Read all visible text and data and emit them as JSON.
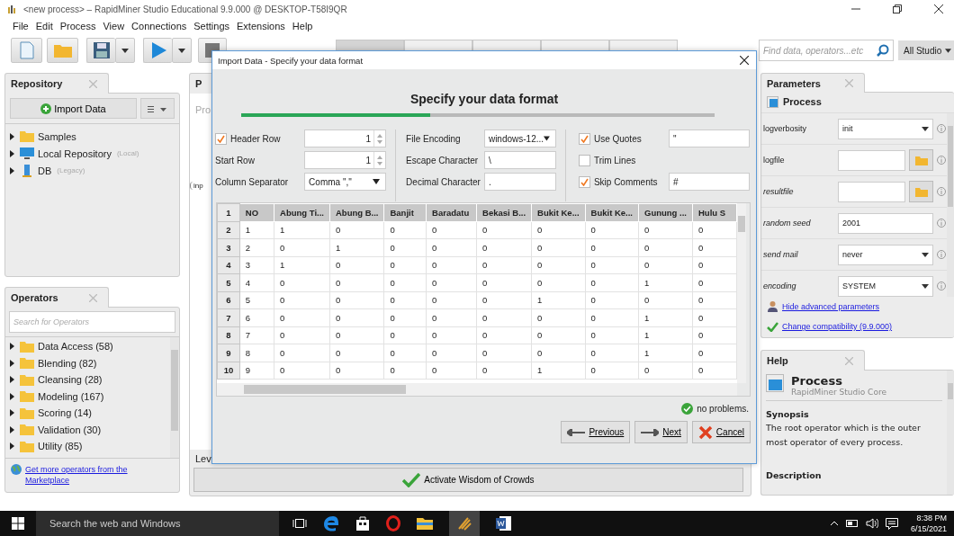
{
  "window": {
    "title": "<new process> – RapidMiner Studio Educational 9.9.000 @ DESKTOP-T58I9QR"
  },
  "menu": [
    "File",
    "Edit",
    "Process",
    "View",
    "Connections",
    "Settings",
    "Extensions",
    "Help"
  ],
  "views": {
    "tabs": [
      {
        "selected": true
      },
      {
        "selected": false
      },
      {
        "selected": false
      },
      {
        "selected": false
      },
      {
        "selected": false
      }
    ]
  },
  "search": {
    "placeholder": "Find data, operators...etc",
    "scope": "All Studio"
  },
  "repository": {
    "title": "Repository",
    "import_button": "Import Data",
    "items": [
      {
        "name": "Samples",
        "kind": "folder"
      },
      {
        "name": "Local Repository",
        "note": "(Local)",
        "kind": "computer"
      },
      {
        "name": "DB",
        "note": "(Legacy)",
        "kind": "database"
      }
    ]
  },
  "operators": {
    "title": "Operators",
    "search_placeholder": "Search for Operators",
    "items": [
      "Data Access (58)",
      "Blending (82)",
      "Cleansing (28)",
      "Modeling (167)",
      "Scoring (14)",
      "Validation (30)",
      "Utility (85)"
    ],
    "marketplace_link": "Get more operators from the Marketplace"
  },
  "process_panel": {
    "title": "P",
    "breadcrumb": "Pro",
    "port": "inp",
    "footer": "Lev",
    "wisdom_button": "Activate Wisdom of Crowds"
  },
  "dialog": {
    "title": "Import Data - Specify your data format",
    "heading": "Specify your data format",
    "progress": {
      "level": 0.4
    },
    "columns": [
      [
        {
          "label": "Header Row",
          "checked": true,
          "kind": "checkspinner",
          "value": "1"
        },
        {
          "label": "Start Row",
          "kind": "spinner",
          "value": "1"
        },
        {
          "label": "Column Separator",
          "kind": "select",
          "value": "Comma \",\""
        }
      ],
      [
        {
          "label": "File Encoding",
          "kind": "select",
          "value": "windows-12..."
        },
        {
          "label": "Escape Character",
          "kind": "text",
          "value": "\\"
        },
        {
          "label": "Decimal Character",
          "kind": "text",
          "value": "."
        }
      ],
      [
        {
          "label": "Use Quotes",
          "checked": true,
          "kind": "checktext",
          "value": "\""
        },
        {
          "label": "Trim Lines",
          "checked": false,
          "kind": "checkbox"
        },
        {
          "label": "Skip Comments",
          "checked": true,
          "kind": "checktext",
          "value": "#"
        }
      ]
    ],
    "table": {
      "header_number": "1",
      "columns": [
        "NO",
        "Abung Ti...",
        "Abung B...",
        "Banjit",
        "Baradatu",
        "Bekasi B...",
        "Bukit Ke...",
        "Bukit Ke...",
        "Gunung ...",
        "Hulu S"
      ],
      "rows": [
        {
          "number": "2",
          "cells": [
            "1",
            "1",
            "0",
            "0",
            "0",
            "0",
            "0",
            "0",
            "0",
            "0"
          ]
        },
        {
          "number": "3",
          "cells": [
            "2",
            "0",
            "1",
            "0",
            "0",
            "0",
            "0",
            "0",
            "0",
            "0"
          ]
        },
        {
          "number": "4",
          "cells": [
            "3",
            "1",
            "0",
            "0",
            "0",
            "0",
            "0",
            "0",
            "0",
            "0"
          ]
        },
        {
          "number": "5",
          "cells": [
            "4",
            "0",
            "0",
            "0",
            "0",
            "0",
            "0",
            "0",
            "1",
            "0"
          ]
        },
        {
          "number": "6",
          "cells": [
            "5",
            "0",
            "0",
            "0",
            "0",
            "0",
            "1",
            "0",
            "0",
            "0"
          ]
        },
        {
          "number": "7",
          "cells": [
            "6",
            "0",
            "0",
            "0",
            "0",
            "0",
            "0",
            "0",
            "1",
            "0"
          ]
        },
        {
          "number": "8",
          "cells": [
            "7",
            "0",
            "0",
            "0",
            "0",
            "0",
            "0",
            "0",
            "1",
            "0"
          ]
        },
        {
          "number": "9",
          "cells": [
            "8",
            "0",
            "0",
            "0",
            "0",
            "0",
            "0",
            "0",
            "1",
            "0"
          ]
        },
        {
          "number": "10",
          "cells": [
            "9",
            "0",
            "0",
            "0",
            "0",
            "0",
            "1",
            "0",
            "0",
            "0"
          ]
        }
      ]
    },
    "status": "no problems.",
    "buttons": [
      {
        "label": "Previous",
        "kind": "previous"
      },
      {
        "label": "Next",
        "kind": "next"
      },
      {
        "label": "Cancel",
        "kind": "cancel"
      }
    ]
  },
  "parameters": {
    "title": "Parameters",
    "operator": "Process",
    "rows": [
      {
        "name": "logverbosity",
        "italic": false,
        "kind": "select",
        "value": "init"
      },
      {
        "name": "logfile",
        "italic": false,
        "kind": "file"
      },
      {
        "name": "resultfile",
        "italic": true,
        "kind": "file"
      },
      {
        "name": "random seed",
        "italic": true,
        "kind": "text",
        "value": "2001"
      },
      {
        "name": "send mail",
        "italic": true,
        "kind": "select",
        "value": "never"
      },
      {
        "name": "encoding",
        "italic": true,
        "kind": "select",
        "value": "SYSTEM"
      }
    ],
    "links": [
      "Hide advanced parameters",
      "Change compatibility (9.9.000)"
    ]
  },
  "help": {
    "title": "Help",
    "operator": "Process",
    "subtitle": "RapidMiner Studio Core",
    "synopsis_heading": "Synopsis",
    "synopsis": "The root operator which is the outer most operator of every process.",
    "description_heading": "Description"
  },
  "taskbar": {
    "search": "Search the web and Windows",
    "time": "8:38 PM",
    "date": "6/15/2021"
  }
}
